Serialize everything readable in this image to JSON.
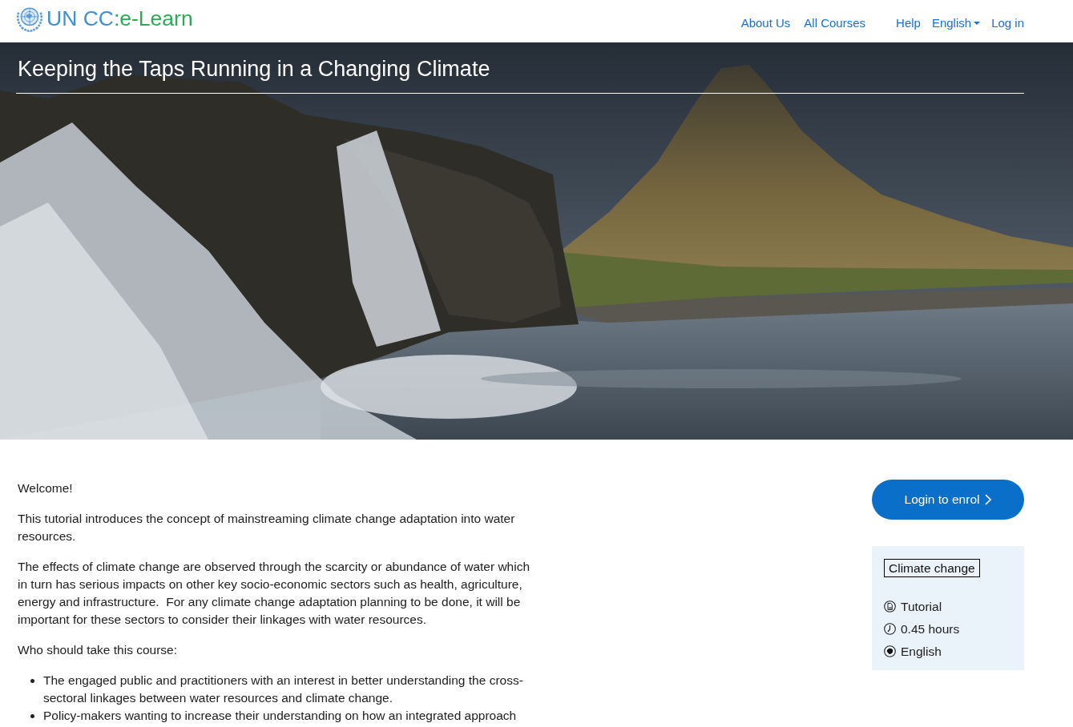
{
  "navbar": {
    "brand": {
      "name": "UN CC",
      "suffix": ":e-Learn"
    },
    "menu": [
      {
        "label": "About Us",
        "kind": "link"
      },
      {
        "label": "All Courses",
        "kind": "link"
      }
    ],
    "tools": [
      {
        "label": "Help",
        "kind": "link"
      },
      {
        "label": "English",
        "kind": "dropdown"
      },
      {
        "label": "Log in",
        "kind": "link"
      }
    ]
  },
  "hero": {
    "title": "Keeping the Taps Running in a Changing Climate"
  },
  "description": {
    "paragraphs": [
      "Welcome!",
      "This tutorial introduces the concept of mainstreaming climate change adaptation into water resources.",
      "The effects of climate change are observed through the scarcity or abundance of water which in turn has serious impacts on other key socio-economic sectors such as health, agriculture, energy and infrastructure.  For any climate change adaptation planning to be done, it will be important for these sectors to consider their linkages with water resources.",
      "Who should take this course:"
    ],
    "audience": [
      "The engaged public and practitioners with an interest in better understanding the cross-sectoral linkages between water resources and climate change.",
      "Policy-makers wanting to increase their understanding on how an integrated approach"
    ]
  },
  "enrol_button": {
    "label": "Login to enrol"
  },
  "course_info": {
    "tag": "Climate change",
    "details": [
      {
        "kind": "type",
        "text": "Tutorial"
      },
      {
        "kind": "duration",
        "text": "0.45 hours"
      },
      {
        "kind": "language",
        "text": "English"
      }
    ]
  }
}
